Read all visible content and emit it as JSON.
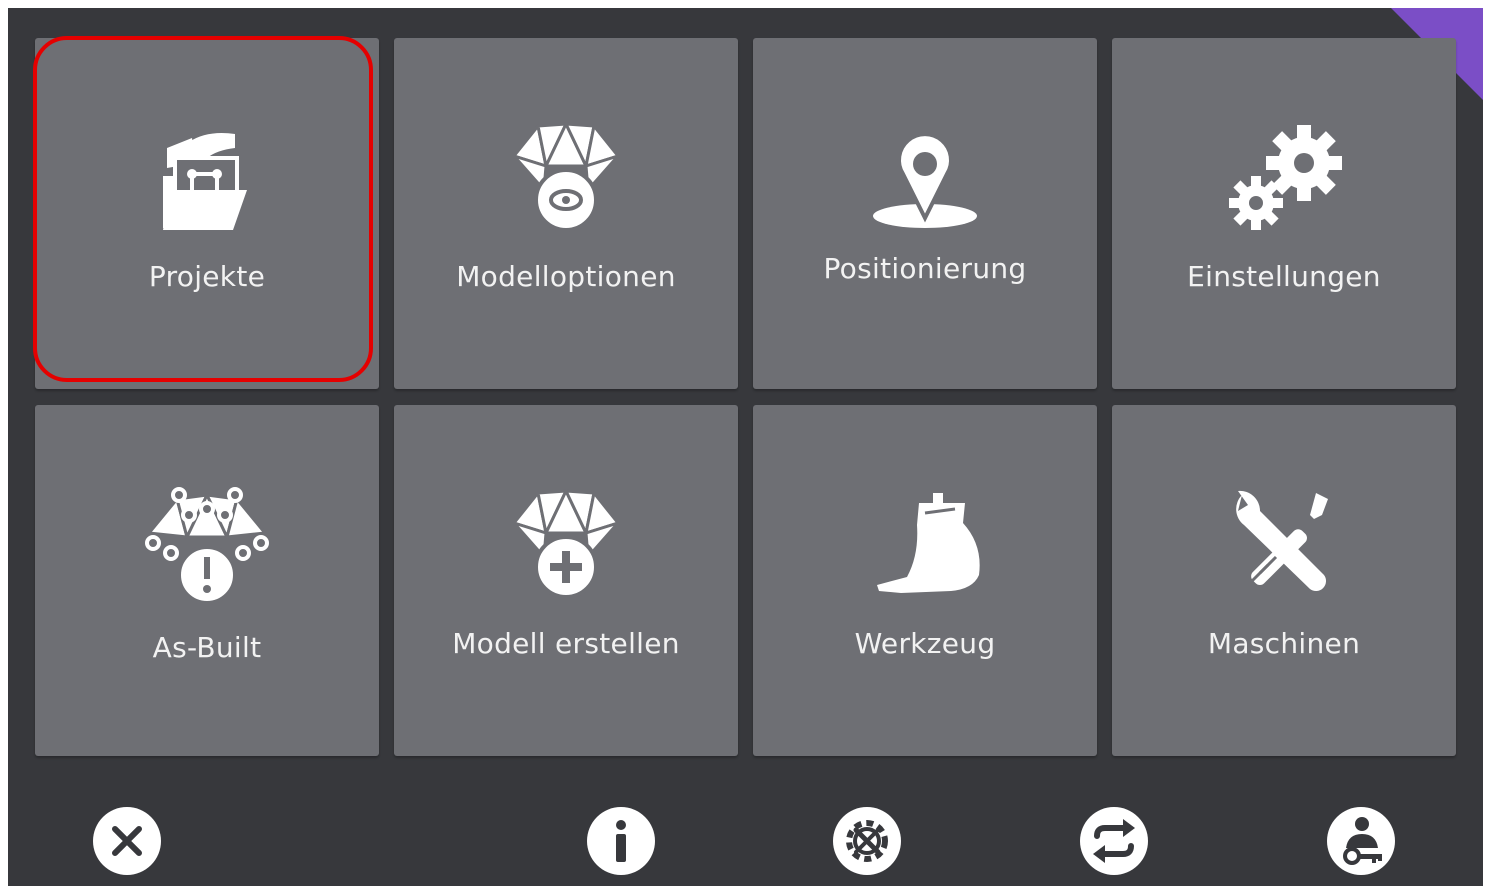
{
  "tiles": [
    {
      "label": "Projekte",
      "icon": "projects-folder-icon"
    },
    {
      "label": "Modelloptionen",
      "icon": "model-view-icon"
    },
    {
      "label": "Positionierung",
      "icon": "location-pin-icon"
    },
    {
      "label": "Einstellungen",
      "icon": "gears-icon"
    },
    {
      "label": "As-Built",
      "icon": "as-built-icon"
    },
    {
      "label": "Modell erstellen",
      "icon": "model-add-icon"
    },
    {
      "label": "Werkzeug",
      "icon": "bucket-icon"
    },
    {
      "label": "Maschinen",
      "icon": "wrench-screwdriver-icon"
    }
  ],
  "bottom_bar": [
    {
      "icon": "close-icon"
    },
    {
      "icon": "info-icon"
    },
    {
      "icon": "gear-wrench-icon"
    },
    {
      "icon": "swap-icon"
    },
    {
      "icon": "operator-key-icon"
    }
  ],
  "colors": {
    "background": "#37383c",
    "tile": "#6e6f74",
    "highlight": "#e50000",
    "corner_accent": "#7b4ec6"
  }
}
